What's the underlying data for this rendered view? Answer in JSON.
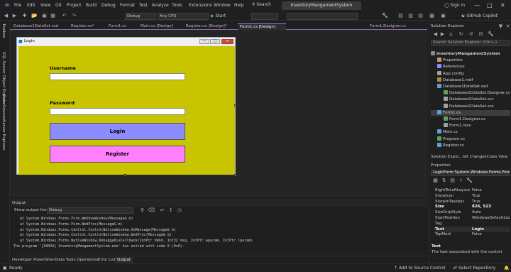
{
  "menubar": {
    "items": [
      "File",
      "Edit",
      "View",
      "Git",
      "Project",
      "Build",
      "Debug",
      "Format",
      "Test",
      "Analyze",
      "Tools",
      "Extensions",
      "Window",
      "Help"
    ],
    "search_label": "Search",
    "solution_title": "InventoryMangamentSystem",
    "signin_label": "Sign in"
  },
  "toolbar": {
    "config": "Debug",
    "platform": "Any CPU",
    "start_label": "Start",
    "copilot_label": "GitHub Copilot"
  },
  "left_tools": [
    "Toolbox",
    "SQL Server Object Explorer",
    "Data Sources",
    "Server Explorer"
  ],
  "doc_tabs": [
    {
      "label": "Database1DataSet.xsd",
      "active": false
    },
    {
      "label": "Register.cs*",
      "active": false
    },
    {
      "label": "Form1.cs",
      "active": false
    },
    {
      "label": "Main.cs [Design]",
      "active": false
    },
    {
      "label": "Register.cs [Design]*",
      "active": false
    },
    {
      "label": "Form1.cs [Design]",
      "active": true
    },
    {
      "label": "Form1.Designer.cs",
      "active": false
    }
  ],
  "form": {
    "title": "Login",
    "username_label": "Username",
    "password_label": "Password",
    "login_button": "Login",
    "register_button": "Register",
    "client_color": "#c8c400",
    "login_color": "#8c8cff",
    "register_color": "#ff80ff"
  },
  "output": {
    "title": "Output",
    "source_label": "Show output from:",
    "source_value": "Debug",
    "lines": [
      "   at System.Windows.Forms.Form.WmShowWindow(Message& m)",
      "   at System.Windows.Forms.Form.WndProc(Message& m)",
      "   at System.Windows.Forms.Control.ControlNativeWindow.OnMessage(Message& m)",
      "   at System.Windows.Forms.Control.ControlNativeWindow.WndProc(Message& m)",
      "   at System.Windows.Forms.NativeWindow.DebuggableCallback(IntPtr hWnd, Int32 msg, IntPtr wparam, IntPtr lparam)",
      "The program '[18604] InventoryMangamentSystem.exe' has exited with code 0 (0x0)."
    ]
  },
  "bottom_tabs": [
    {
      "label": "Developer PowerShell",
      "active": false
    },
    {
      "label": "Data Tools Operations",
      "active": false
    },
    {
      "label": "Error List",
      "active": false
    },
    {
      "label": "Output",
      "active": true
    }
  ],
  "solution_explorer": {
    "title": "Solution Explorer",
    "search_placeholder": "Search Solution Explorer (Ctrl+;)",
    "items": [
      {
        "label": "InventoryMangamentSystem",
        "depth": 0,
        "icon_color": "#8a8a8a",
        "selected": false,
        "bold": true
      },
      {
        "label": "Properties",
        "depth": 1,
        "icon_color": "#c0a060",
        "selected": false
      },
      {
        "label": "References",
        "depth": 1,
        "icon_color": "#8a8aff",
        "selected": false
      },
      {
        "label": "App.config",
        "depth": 1,
        "icon_color": "#a0a0a0",
        "selected": false
      },
      {
        "label": "Database1.mdf",
        "depth": 1,
        "icon_color": "#c08040",
        "selected": false
      },
      {
        "label": "Database1DataSet.xsd",
        "depth": 1,
        "icon_color": "#60a0d0",
        "selected": false
      },
      {
        "label": "Database1DataSet.Designer.cs",
        "depth": 2,
        "icon_color": "#60a060",
        "selected": false
      },
      {
        "label": "Database1DataSet.xsc",
        "depth": 2,
        "icon_color": "#a0a0a0",
        "selected": false
      },
      {
        "label": "Database1DataSet.xss",
        "depth": 2,
        "icon_color": "#a0a0a0",
        "selected": false
      },
      {
        "label": "Form1.cs",
        "depth": 1,
        "icon_color": "#5aa0e6",
        "selected": true
      },
      {
        "label": "Form1.Designer.cs",
        "depth": 2,
        "icon_color": "#60a060",
        "selected": false
      },
      {
        "label": "Form1.resx",
        "depth": 2,
        "icon_color": "#a0a0a0",
        "selected": false
      },
      {
        "label": "Main.cs",
        "depth": 1,
        "icon_color": "#5aa0e6",
        "selected": false
      },
      {
        "label": "Program.cs",
        "depth": 1,
        "icon_color": "#60a060",
        "selected": false
      },
      {
        "label": "Register.cs",
        "depth": 1,
        "icon_color": "#5aa0e6",
        "selected": false
      }
    ],
    "tabs": [
      "Solution Explo...",
      "Git Changes",
      "Class View"
    ]
  },
  "properties": {
    "title": "Properties",
    "object": "LoginForm  System.Windows.Forms.Form",
    "rows": [
      {
        "name": "RightToLeftLayout",
        "value": "False",
        "bold": false,
        "selected": false
      },
      {
        "name": "ShowIcon",
        "value": "True",
        "bold": false,
        "selected": false
      },
      {
        "name": "ShowInTaskbar",
        "value": "True",
        "bold": false,
        "selected": false
      },
      {
        "name": "Size",
        "value": "826, 523",
        "bold": true,
        "selected": false
      },
      {
        "name": "SizeGripStyle",
        "value": "Auto",
        "bold": false,
        "selected": false
      },
      {
        "name": "StartPosition",
        "value": "WindowsDefaultLoc",
        "bold": false,
        "selected": false
      },
      {
        "name": "Tag",
        "value": "",
        "bold": false,
        "selected": false
      },
      {
        "name": "Text",
        "value": "Login",
        "bold": true,
        "selected": true
      },
      {
        "name": "TopMost",
        "value": "False",
        "bold": false,
        "selected": false
      }
    ],
    "desc_title": "Text",
    "desc_text": "The text associated with the control."
  },
  "statusbar": {
    "ready": "Ready",
    "source_control": "Add to Source Control",
    "repository": "Select Repository"
  }
}
